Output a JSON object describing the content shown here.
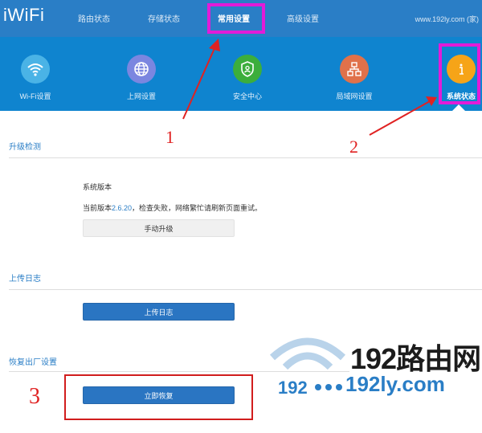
{
  "header": {
    "logo": "iWiFi",
    "nav": [
      {
        "label": "路由状态"
      },
      {
        "label": "存储状态"
      },
      {
        "label": "常用设置"
      },
      {
        "label": "高级设置"
      }
    ],
    "domain": "www.192ly.com (家)"
  },
  "iconbar": {
    "items": [
      {
        "label": "Wi-Fi设置",
        "color": "#4ab3e6"
      },
      {
        "label": "上网设置",
        "color": "#7b86e0"
      },
      {
        "label": "安全中心",
        "color": "#3cae3c"
      },
      {
        "label": "局域网设置",
        "color": "#e0714a"
      },
      {
        "label": "系统状态",
        "color": "#f6a418"
      }
    ]
  },
  "sections": {
    "upgrade": {
      "title": "升级检测",
      "version_label": "系统版本",
      "status_prefix": "当前版本",
      "version": "2.6.20",
      "status_suffix": "，检查失败，网络繁忙请刷新页面重试。",
      "button": "手动升级"
    },
    "log": {
      "title": "上传日志",
      "button": "上传日志"
    },
    "reset": {
      "title": "恢复出厂设置",
      "button": "立即恢复"
    }
  },
  "annotations": {
    "n1": "1",
    "n2": "2",
    "n3": "3",
    "color": "#e02222"
  },
  "watermark": {
    "cn": "192路由网",
    "ip": "192",
    "url": "192ly.com"
  }
}
